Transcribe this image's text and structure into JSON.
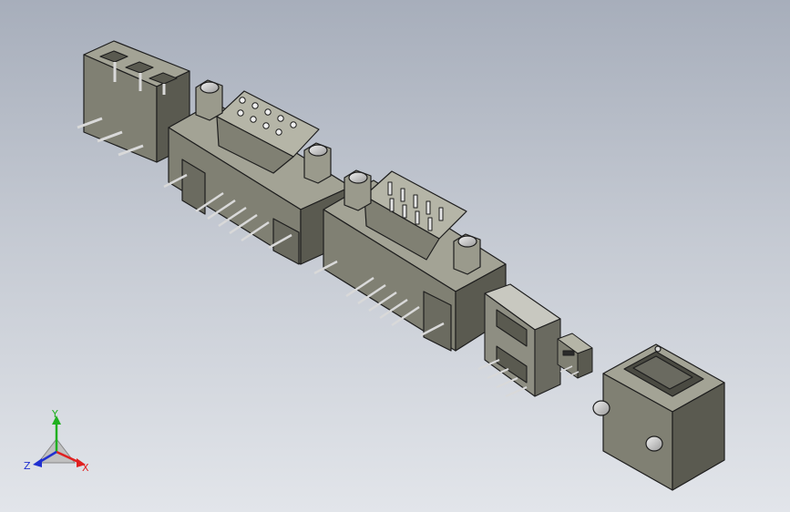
{
  "viewport": {
    "background_top": "#a7aebb",
    "background_bottom": "#e2e5ea"
  },
  "model": {
    "body_color": "#808073",
    "body_dark": "#5a5a50",
    "body_light": "#a3a395",
    "edge_color": "#1e1e1e",
    "metal_color": "#d9d9d9",
    "components": [
      "terminal-block-connector",
      "db9-female-connector",
      "db9-male-connector",
      "usb-a-connector",
      "micro-usb-connector",
      "rj-jack-connector"
    ]
  },
  "triad": {
    "x_label": "X",
    "y_label": "Y",
    "z_label": "Z",
    "x_color": "#e02020",
    "y_color": "#20b020",
    "z_color": "#2030d0"
  }
}
